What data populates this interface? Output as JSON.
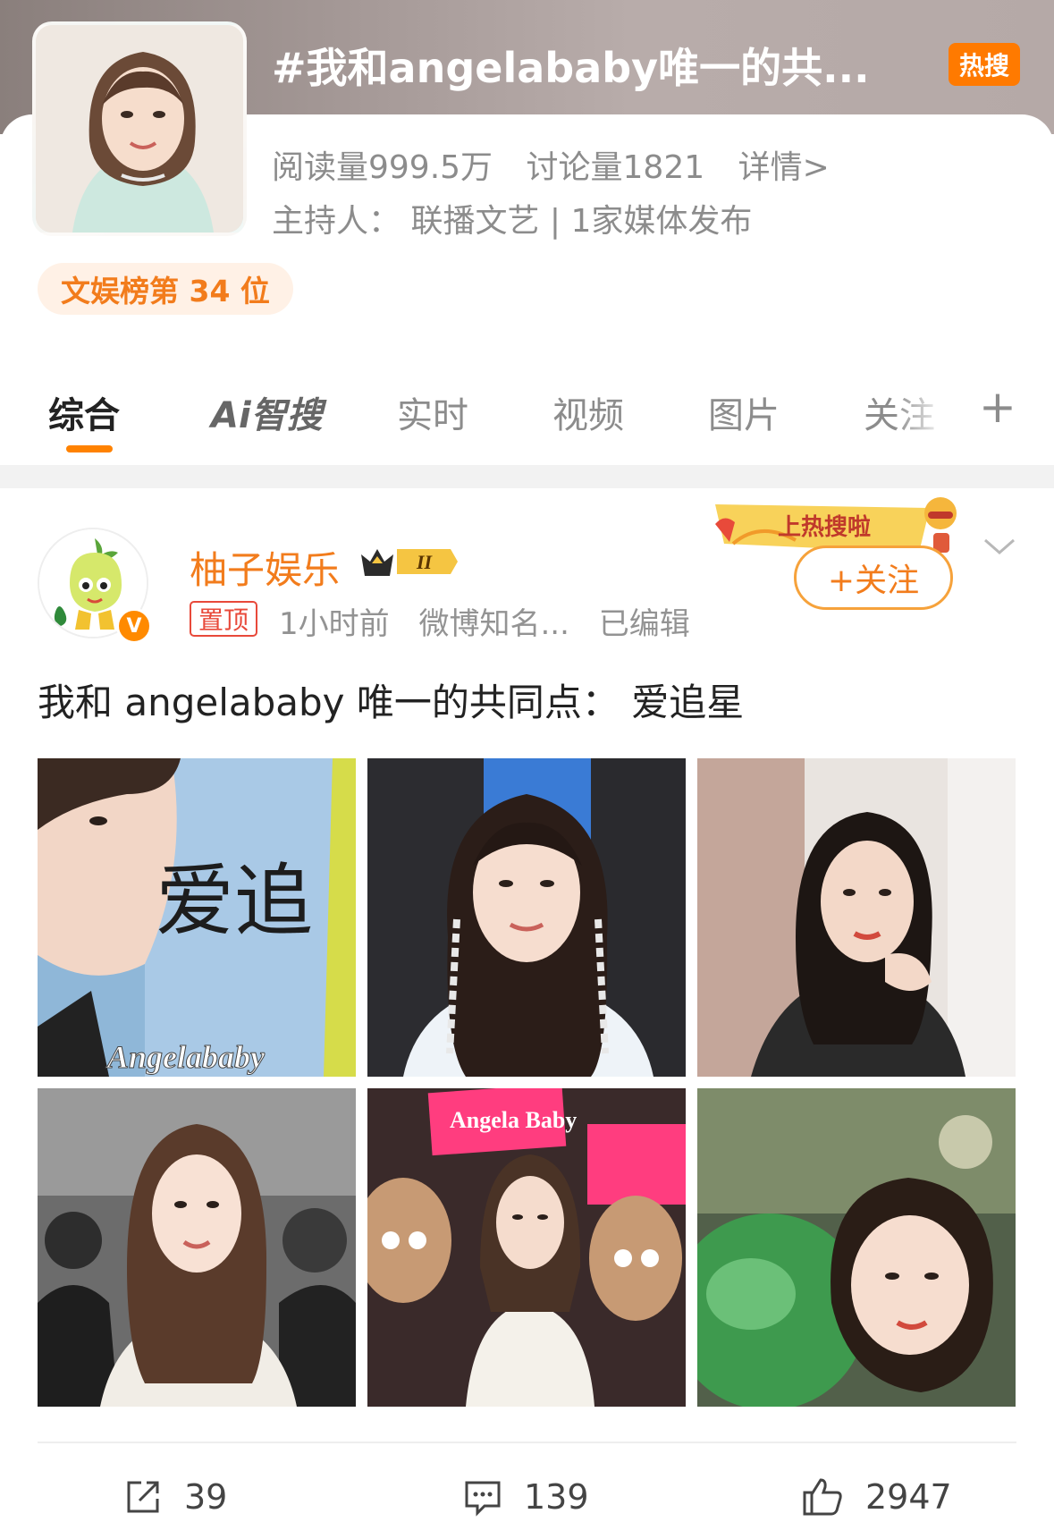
{
  "topic": {
    "title": "#我和angelababy唯一的共...",
    "hot_badge": "热搜",
    "reads": "阅读量999.5万",
    "discussions": "讨论量1821",
    "details_link": "详情>",
    "host": "主持人：  联播文艺 | 1家媒体发布",
    "rank": "文娱榜第 34 位"
  },
  "tabs": [
    {
      "label": "综合"
    },
    {
      "label": "Ai智搜"
    },
    {
      "label": "实时"
    },
    {
      "label": "视频"
    },
    {
      "label": "图片"
    },
    {
      "label": "关注"
    }
  ],
  "tabs_more": "+",
  "post": {
    "username": "柚子娱乐",
    "vip_level": "II",
    "pin_label": "置顶",
    "time": "1小时前",
    "source": "微博知名...",
    "edited": "已编辑",
    "sticker_text": "上热搜啦",
    "follow_label": "+关注",
    "text": "我和 angelababy 唯一的共同点：  爱追星",
    "photo_captions": {
      "p1_handwriting": "爱追",
      "p1_watermark": "Angelababy",
      "p5_sign": "Angela Baby"
    },
    "actions": {
      "shares": "39",
      "comments": "139",
      "likes": "2947"
    }
  },
  "colors": {
    "accent": "#ff8200",
    "username": "#f27c1c",
    "hot_badge": "#ff7a00",
    "pin_red": "#e8493a"
  }
}
